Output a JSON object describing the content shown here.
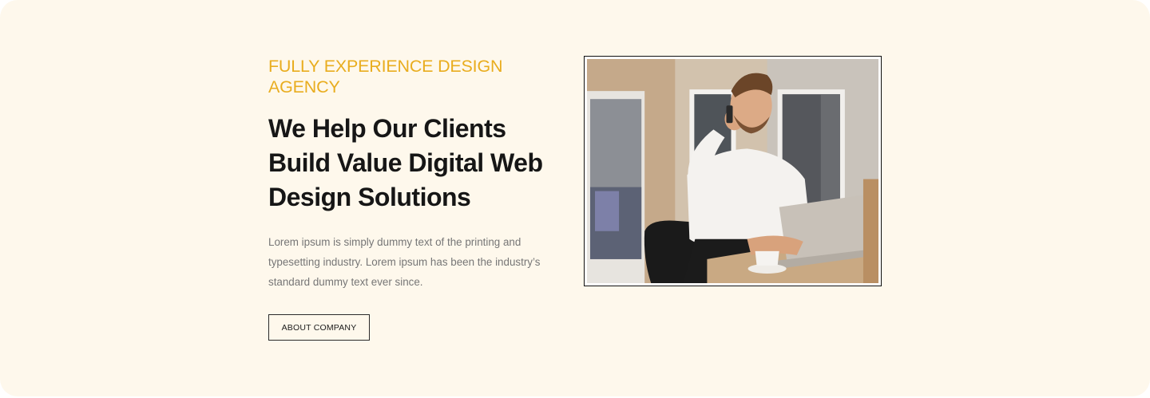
{
  "hero": {
    "eyebrow": "FULLY EXPERIENCE DESIGN AGENCY",
    "headline": "We Help Our Clients Build Value Digital Web Design Solutions",
    "body": "Lorem ipsum is simply dummy text of the printing and typesetting industry. Lorem ipsum has been the industry’s standard dummy text ever since.",
    "cta_label": "ABOUT COMPANY"
  },
  "colors": {
    "background": "#fef8ec",
    "accent": "#e9ad1f",
    "headline": "#161616",
    "body": "#767676"
  },
  "image": {
    "subject": "man-on-phone-with-laptop-photo"
  }
}
